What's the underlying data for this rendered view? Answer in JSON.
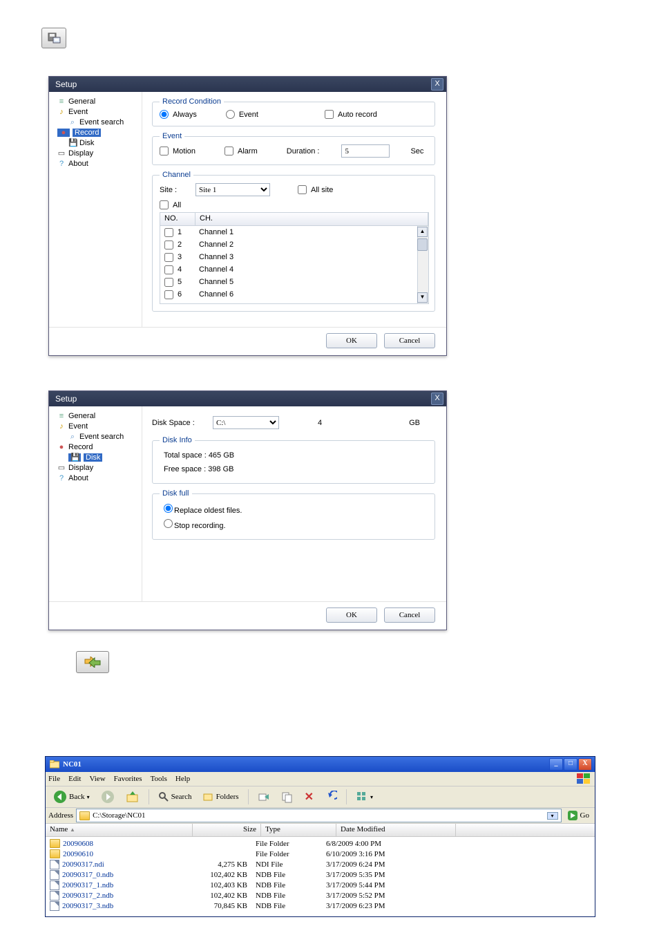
{
  "mini_icons": {
    "top": "floppy-monitor-icon",
    "mid": "arrows-transfer-icon"
  },
  "setup1": {
    "title": "Setup",
    "tree": [
      {
        "label": "General",
        "icon": "list"
      },
      {
        "label": "Event",
        "icon": "bell"
      },
      {
        "label": "Event search",
        "icon": "find",
        "sub": true
      },
      {
        "label": "Record",
        "icon": "rec",
        "sel": true
      },
      {
        "label": "Disk",
        "icon": "disk",
        "sub": true
      },
      {
        "label": "Display",
        "icon": "mon"
      },
      {
        "label": "About",
        "icon": "q"
      }
    ],
    "record_condition": {
      "legend": "Record Condition",
      "always": "Always",
      "event": "Event",
      "auto": "Auto record",
      "sel": "always"
    },
    "event": {
      "legend": "Event",
      "motion": "Motion",
      "alarm": "Alarm",
      "duration_label": "Duration :",
      "duration_value": "5",
      "sec": "Sec"
    },
    "channel": {
      "legend": "Channel",
      "site_label": "Site :",
      "site_value": "Site 1",
      "all_site": "All site",
      "all": "All",
      "cols": {
        "no": "NO.",
        "ch": "CH."
      },
      "rows": [
        {
          "no": "1",
          "ch": "Channel 1"
        },
        {
          "no": "2",
          "ch": "Channel 2"
        },
        {
          "no": "3",
          "ch": "Channel 3"
        },
        {
          "no": "4",
          "ch": "Channel 4"
        },
        {
          "no": "5",
          "ch": "Channel 5"
        },
        {
          "no": "6",
          "ch": "Channel 6"
        }
      ]
    },
    "buttons": {
      "ok": "OK",
      "cancel": "Cancel"
    }
  },
  "setup2": {
    "title": "Setup",
    "tree": [
      {
        "label": "General",
        "icon": "list"
      },
      {
        "label": "Event",
        "icon": "bell"
      },
      {
        "label": "Event search",
        "icon": "find",
        "sub": true
      },
      {
        "label": "Record",
        "icon": "rec"
      },
      {
        "label": "Disk",
        "icon": "disk",
        "sub": true,
        "sel": true
      },
      {
        "label": "Display",
        "icon": "mon"
      },
      {
        "label": "About",
        "icon": "q"
      }
    ],
    "disk_space": {
      "label": "Disk Space :",
      "drive": "C:\\",
      "value": "4",
      "unit": "GB"
    },
    "disk_info": {
      "legend": "Disk Info",
      "total": "Total space : 465 GB",
      "free": "Free space : 398 GB"
    },
    "disk_full": {
      "legend": "Disk full",
      "replace": "Replace oldest files.",
      "stop": "Stop recording.",
      "sel": "replace"
    },
    "buttons": {
      "ok": "OK",
      "cancel": "Cancel"
    }
  },
  "explorer": {
    "title": "NC01",
    "menu": [
      "File",
      "Edit",
      "View",
      "Favorites",
      "Tools",
      "Help"
    ],
    "toolbar": {
      "back": "Back",
      "search": "Search",
      "folders": "Folders"
    },
    "address_label": "Address",
    "address_value": "C:\\Storage\\NC01",
    "go": "Go",
    "cols": {
      "name": "Name",
      "size": "Size",
      "type": "Type",
      "date": "Date Modified"
    },
    "rows": [
      {
        "icon": "folder",
        "name": "20090608",
        "size": "",
        "type": "File Folder",
        "date": "6/8/2009 4:00 PM"
      },
      {
        "icon": "folder",
        "name": "20090610",
        "size": "",
        "type": "File Folder",
        "date": "6/10/2009 3:16 PM"
      },
      {
        "icon": "file",
        "name": "20090317.ndi",
        "size": "4,275 KB",
        "type": "NDI File",
        "date": "3/17/2009 6:24 PM"
      },
      {
        "icon": "file",
        "name": "20090317_0.ndb",
        "size": "102,402 KB",
        "type": "NDB File",
        "date": "3/17/2009 5:35 PM"
      },
      {
        "icon": "file",
        "name": "20090317_1.ndb",
        "size": "102,403 KB",
        "type": "NDB File",
        "date": "3/17/2009 5:44 PM"
      },
      {
        "icon": "file",
        "name": "20090317_2.ndb",
        "size": "102,402 KB",
        "type": "NDB File",
        "date": "3/17/2009 5:52 PM"
      },
      {
        "icon": "file",
        "name": "20090317_3.ndb",
        "size": "70,845 KB",
        "type": "NDB File",
        "date": "3/17/2009 6:23 PM"
      }
    ]
  }
}
